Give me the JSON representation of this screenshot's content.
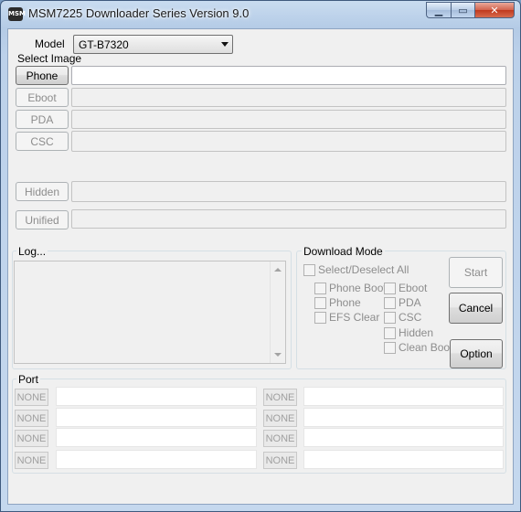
{
  "window": {
    "title": "MSM7225 Downloader Series Version 9.0",
    "icon_text": "MSM",
    "controls": {
      "minimize": "▁",
      "maximize": "▭",
      "close": "✕"
    }
  },
  "model": {
    "label": "Model",
    "value": "GT-B7320"
  },
  "select_image": {
    "label": "Select Image",
    "buttons": {
      "phone": "Phone",
      "eboot": "Eboot",
      "pda": "PDA",
      "csc": "CSC",
      "hidden": "Hidden",
      "unified": "Unified"
    }
  },
  "log": {
    "label": "Log..."
  },
  "download_mode": {
    "label": "Download Mode",
    "select_all": "Select/Deselect All",
    "options": {
      "phone_boot": "Phone Boot",
      "phone": "Phone",
      "efs_clear": "EFS Clear",
      "eboot": "Eboot",
      "pda": "PDA",
      "csc": "CSC",
      "hidden": "Hidden",
      "clean_boot": "Clean Boot"
    },
    "buttons": {
      "start": "Start",
      "cancel": "Cancel",
      "option": "Option"
    }
  },
  "port": {
    "label": "Port",
    "slots": [
      "NONE",
      "NONE",
      "NONE",
      "NONE",
      "NONE",
      "NONE",
      "NONE",
      "NONE"
    ]
  }
}
